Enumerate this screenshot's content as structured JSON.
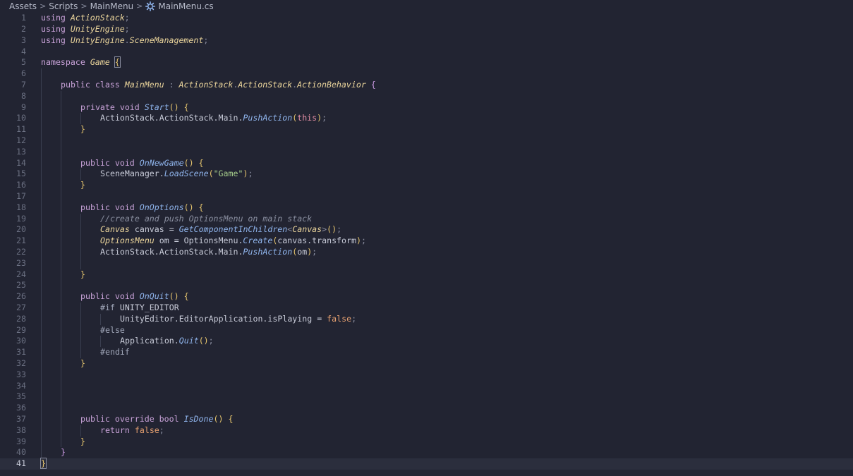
{
  "breadcrumb": {
    "items": [
      "Assets",
      "Scripts",
      "MainMenu",
      "MainMenu.cs"
    ],
    "separator": ">",
    "file_icon": "csharp-gear-icon"
  },
  "colors": {
    "background": "#222432",
    "keyword": "#c8a2d8",
    "type": "#ead49b",
    "function": "#8fb4ec",
    "string": "#a8d08d",
    "comment": "#8a8fa0",
    "literal": "#e5a070",
    "this": "#e58fa6"
  },
  "editor": {
    "current_line": 41,
    "lines": [
      {
        "n": "1",
        "indent": 0,
        "tokens": [
          [
            "kw",
            "using "
          ],
          [
            "ty",
            "ActionStack"
          ],
          [
            "pu",
            ";"
          ]
        ]
      },
      {
        "n": "2",
        "indent": 0,
        "tokens": [
          [
            "kw",
            "using "
          ],
          [
            "ty",
            "UnityEngine"
          ],
          [
            "pu",
            ";"
          ]
        ]
      },
      {
        "n": "3",
        "indent": 0,
        "tokens": [
          [
            "kw",
            "using "
          ],
          [
            "ty",
            "UnityEngine"
          ],
          [
            "pu",
            "."
          ],
          [
            "ty",
            "SceneManagement"
          ],
          [
            "pu",
            ";"
          ]
        ]
      },
      {
        "n": "4",
        "indent": 0,
        "tokens": []
      },
      {
        "n": "5",
        "indent": 0,
        "tokens": [
          [
            "kw",
            "namespace "
          ],
          [
            "ty",
            "Game"
          ],
          [
            "pl",
            " "
          ],
          [
            "br1h",
            "{"
          ]
        ]
      },
      {
        "n": "6",
        "indent": 1,
        "tokens": []
      },
      {
        "n": "7",
        "indent": 1,
        "tokens": [
          [
            "kw",
            "public class "
          ],
          [
            "ty",
            "MainMenu"
          ],
          [
            "pu",
            " : "
          ],
          [
            "ty",
            "ActionStack"
          ],
          [
            "pu",
            "."
          ],
          [
            "ty",
            "ActionStack"
          ],
          [
            "pu",
            "."
          ],
          [
            "ty",
            "ActionBehavior"
          ],
          [
            "pl",
            " "
          ],
          [
            "br2",
            "{"
          ]
        ]
      },
      {
        "n": "8",
        "indent": 2,
        "tokens": []
      },
      {
        "n": "9",
        "indent": 2,
        "tokens": [
          [
            "kw",
            "private void "
          ],
          [
            "fn",
            "Start"
          ],
          [
            "br1",
            "()"
          ],
          [
            "pl",
            " "
          ],
          [
            "br1",
            "{"
          ]
        ]
      },
      {
        "n": "10",
        "indent": 3,
        "tokens": [
          [
            "pl",
            "ActionStack.ActionStack.Main."
          ],
          [
            "fn",
            "PushAction"
          ],
          [
            "br1",
            "("
          ],
          [
            "th",
            "this"
          ],
          [
            "br1",
            ")"
          ],
          [
            "pu",
            ";"
          ]
        ]
      },
      {
        "n": "11",
        "indent": 2,
        "tokens": [
          [
            "br1",
            "}"
          ]
        ]
      },
      {
        "n": "12",
        "indent": 2,
        "tokens": []
      },
      {
        "n": "13",
        "indent": 2,
        "tokens": []
      },
      {
        "n": "14",
        "indent": 2,
        "tokens": [
          [
            "kw",
            "public void "
          ],
          [
            "fn",
            "OnNewGame"
          ],
          [
            "br1",
            "()"
          ],
          [
            "pl",
            " "
          ],
          [
            "br1",
            "{"
          ]
        ]
      },
      {
        "n": "15",
        "indent": 3,
        "tokens": [
          [
            "pl",
            "SceneManager."
          ],
          [
            "fn",
            "LoadScene"
          ],
          [
            "br1",
            "("
          ],
          [
            "str",
            "\"Game\""
          ],
          [
            "br1",
            ")"
          ],
          [
            "pu",
            ";"
          ]
        ]
      },
      {
        "n": "16",
        "indent": 2,
        "tokens": [
          [
            "br1",
            "}"
          ]
        ]
      },
      {
        "n": "17",
        "indent": 2,
        "tokens": []
      },
      {
        "n": "18",
        "indent": 2,
        "tokens": [
          [
            "kw",
            "public void "
          ],
          [
            "fn",
            "OnOptions"
          ],
          [
            "br1",
            "()"
          ],
          [
            "pl",
            " "
          ],
          [
            "br1",
            "{"
          ]
        ]
      },
      {
        "n": "19",
        "indent": 3,
        "tokens": [
          [
            "cm",
            "//create and push OptionsMenu on main stack"
          ]
        ]
      },
      {
        "n": "20",
        "indent": 3,
        "tokens": [
          [
            "ty",
            "Canvas"
          ],
          [
            "pl",
            " canvas = "
          ],
          [
            "fn",
            "GetComponentInChildren"
          ],
          [
            "pu",
            "<"
          ],
          [
            "ty",
            "Canvas"
          ],
          [
            "pu",
            ">"
          ],
          [
            "br1",
            "()"
          ],
          [
            "pu",
            ";"
          ]
        ]
      },
      {
        "n": "21",
        "indent": 3,
        "tokens": [
          [
            "ty",
            "OptionsMenu"
          ],
          [
            "pl",
            " om = OptionsMenu."
          ],
          [
            "fn",
            "Create"
          ],
          [
            "br1",
            "("
          ],
          [
            "pl",
            "canvas.transform"
          ],
          [
            "br1",
            ")"
          ],
          [
            "pu",
            ";"
          ]
        ]
      },
      {
        "n": "22",
        "indent": 3,
        "tokens": [
          [
            "pl",
            "ActionStack.ActionStack.Main."
          ],
          [
            "fn",
            "PushAction"
          ],
          [
            "br1",
            "("
          ],
          [
            "pl",
            "om"
          ],
          [
            "br1",
            ")"
          ],
          [
            "pu",
            ";"
          ]
        ]
      },
      {
        "n": "23",
        "indent": 3,
        "tokens": []
      },
      {
        "n": "24",
        "indent": 2,
        "tokens": [
          [
            "br1",
            "}"
          ]
        ]
      },
      {
        "n": "25",
        "indent": 2,
        "tokens": []
      },
      {
        "n": "26",
        "indent": 2,
        "tokens": [
          [
            "kw",
            "public void "
          ],
          [
            "fn",
            "OnQuit"
          ],
          [
            "br1",
            "()"
          ],
          [
            "pl",
            " "
          ],
          [
            "br1",
            "{"
          ]
        ]
      },
      {
        "n": "27",
        "indent": 3,
        "tokens": [
          [
            "pp",
            "#if "
          ],
          [
            "pl",
            "UNITY_EDITOR"
          ]
        ]
      },
      {
        "n": "28",
        "indent": 4,
        "tokens": [
          [
            "pl",
            "UnityEditor.EditorApplication.isPlaying = "
          ],
          [
            "lit",
            "false"
          ],
          [
            "pu",
            ";"
          ]
        ]
      },
      {
        "n": "29",
        "indent": 3,
        "tokens": [
          [
            "pp",
            "#else"
          ]
        ]
      },
      {
        "n": "30",
        "indent": 4,
        "tokens": [
          [
            "pl",
            "Application."
          ],
          [
            "fn",
            "Quit"
          ],
          [
            "br1",
            "()"
          ],
          [
            "pu",
            ";"
          ]
        ]
      },
      {
        "n": "31",
        "indent": 3,
        "tokens": [
          [
            "pp",
            "#endif"
          ]
        ]
      },
      {
        "n": "32",
        "indent": 2,
        "tokens": [
          [
            "br1",
            "}"
          ]
        ]
      },
      {
        "n": "33",
        "indent": 2,
        "tokens": []
      },
      {
        "n": "34",
        "indent": 2,
        "tokens": []
      },
      {
        "n": "35",
        "indent": 2,
        "tokens": []
      },
      {
        "n": "36",
        "indent": 2,
        "tokens": []
      },
      {
        "n": "37",
        "indent": 2,
        "tokens": [
          [
            "kw",
            "public override bool "
          ],
          [
            "fn",
            "IsDone"
          ],
          [
            "br1",
            "()"
          ],
          [
            "pl",
            " "
          ],
          [
            "br1",
            "{"
          ]
        ]
      },
      {
        "n": "38",
        "indent": 3,
        "tokens": [
          [
            "kw",
            "return "
          ],
          [
            "lit",
            "false"
          ],
          [
            "pu",
            ";"
          ]
        ]
      },
      {
        "n": "39",
        "indent": 2,
        "tokens": [
          [
            "br1",
            "}"
          ]
        ]
      },
      {
        "n": "40",
        "indent": 1,
        "tokens": [
          [
            "br2",
            "}"
          ]
        ]
      },
      {
        "n": "41",
        "indent": 0,
        "tokens": [
          [
            "br1h",
            "}"
          ]
        ]
      }
    ]
  }
}
